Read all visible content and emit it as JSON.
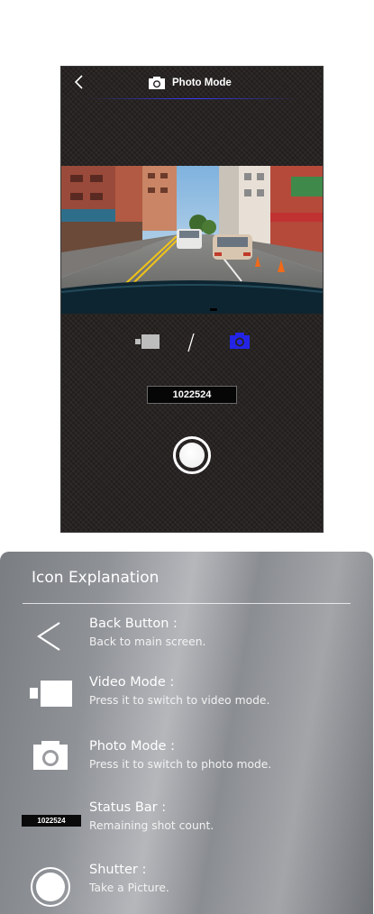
{
  "screen": {
    "back_icon": "chevron-left-icon",
    "title": "Photo Mode",
    "title_icon": "camera-icon",
    "mode_switch": {
      "video_icon": "video-camera-icon",
      "photo_icon": "camera-icon",
      "active": "photo",
      "active_color": "#2424e6",
      "inactive_color": "#bdbdbd"
    },
    "status_count": "1022524",
    "shutter_icon": "shutter-button-icon"
  },
  "explanation": {
    "title": "Icon Explanation",
    "items": [
      {
        "icon": "chevron-left-icon",
        "title": "Back Button :",
        "desc": "Back to main screen."
      },
      {
        "icon": "video-camera-icon",
        "title": "Video Mode :",
        "desc": "Press it to switch to video mode."
      },
      {
        "icon": "camera-icon",
        "title": "Photo Mode :",
        "desc": "Press it to switch to photo mode."
      },
      {
        "icon": "status-bar-icon",
        "status_sample": "1022524",
        "title": "Status Bar :",
        "desc": "Remaining shot count."
      },
      {
        "icon": "shutter-icon",
        "title": "Shutter :",
        "desc": "Take a Picture."
      }
    ]
  }
}
